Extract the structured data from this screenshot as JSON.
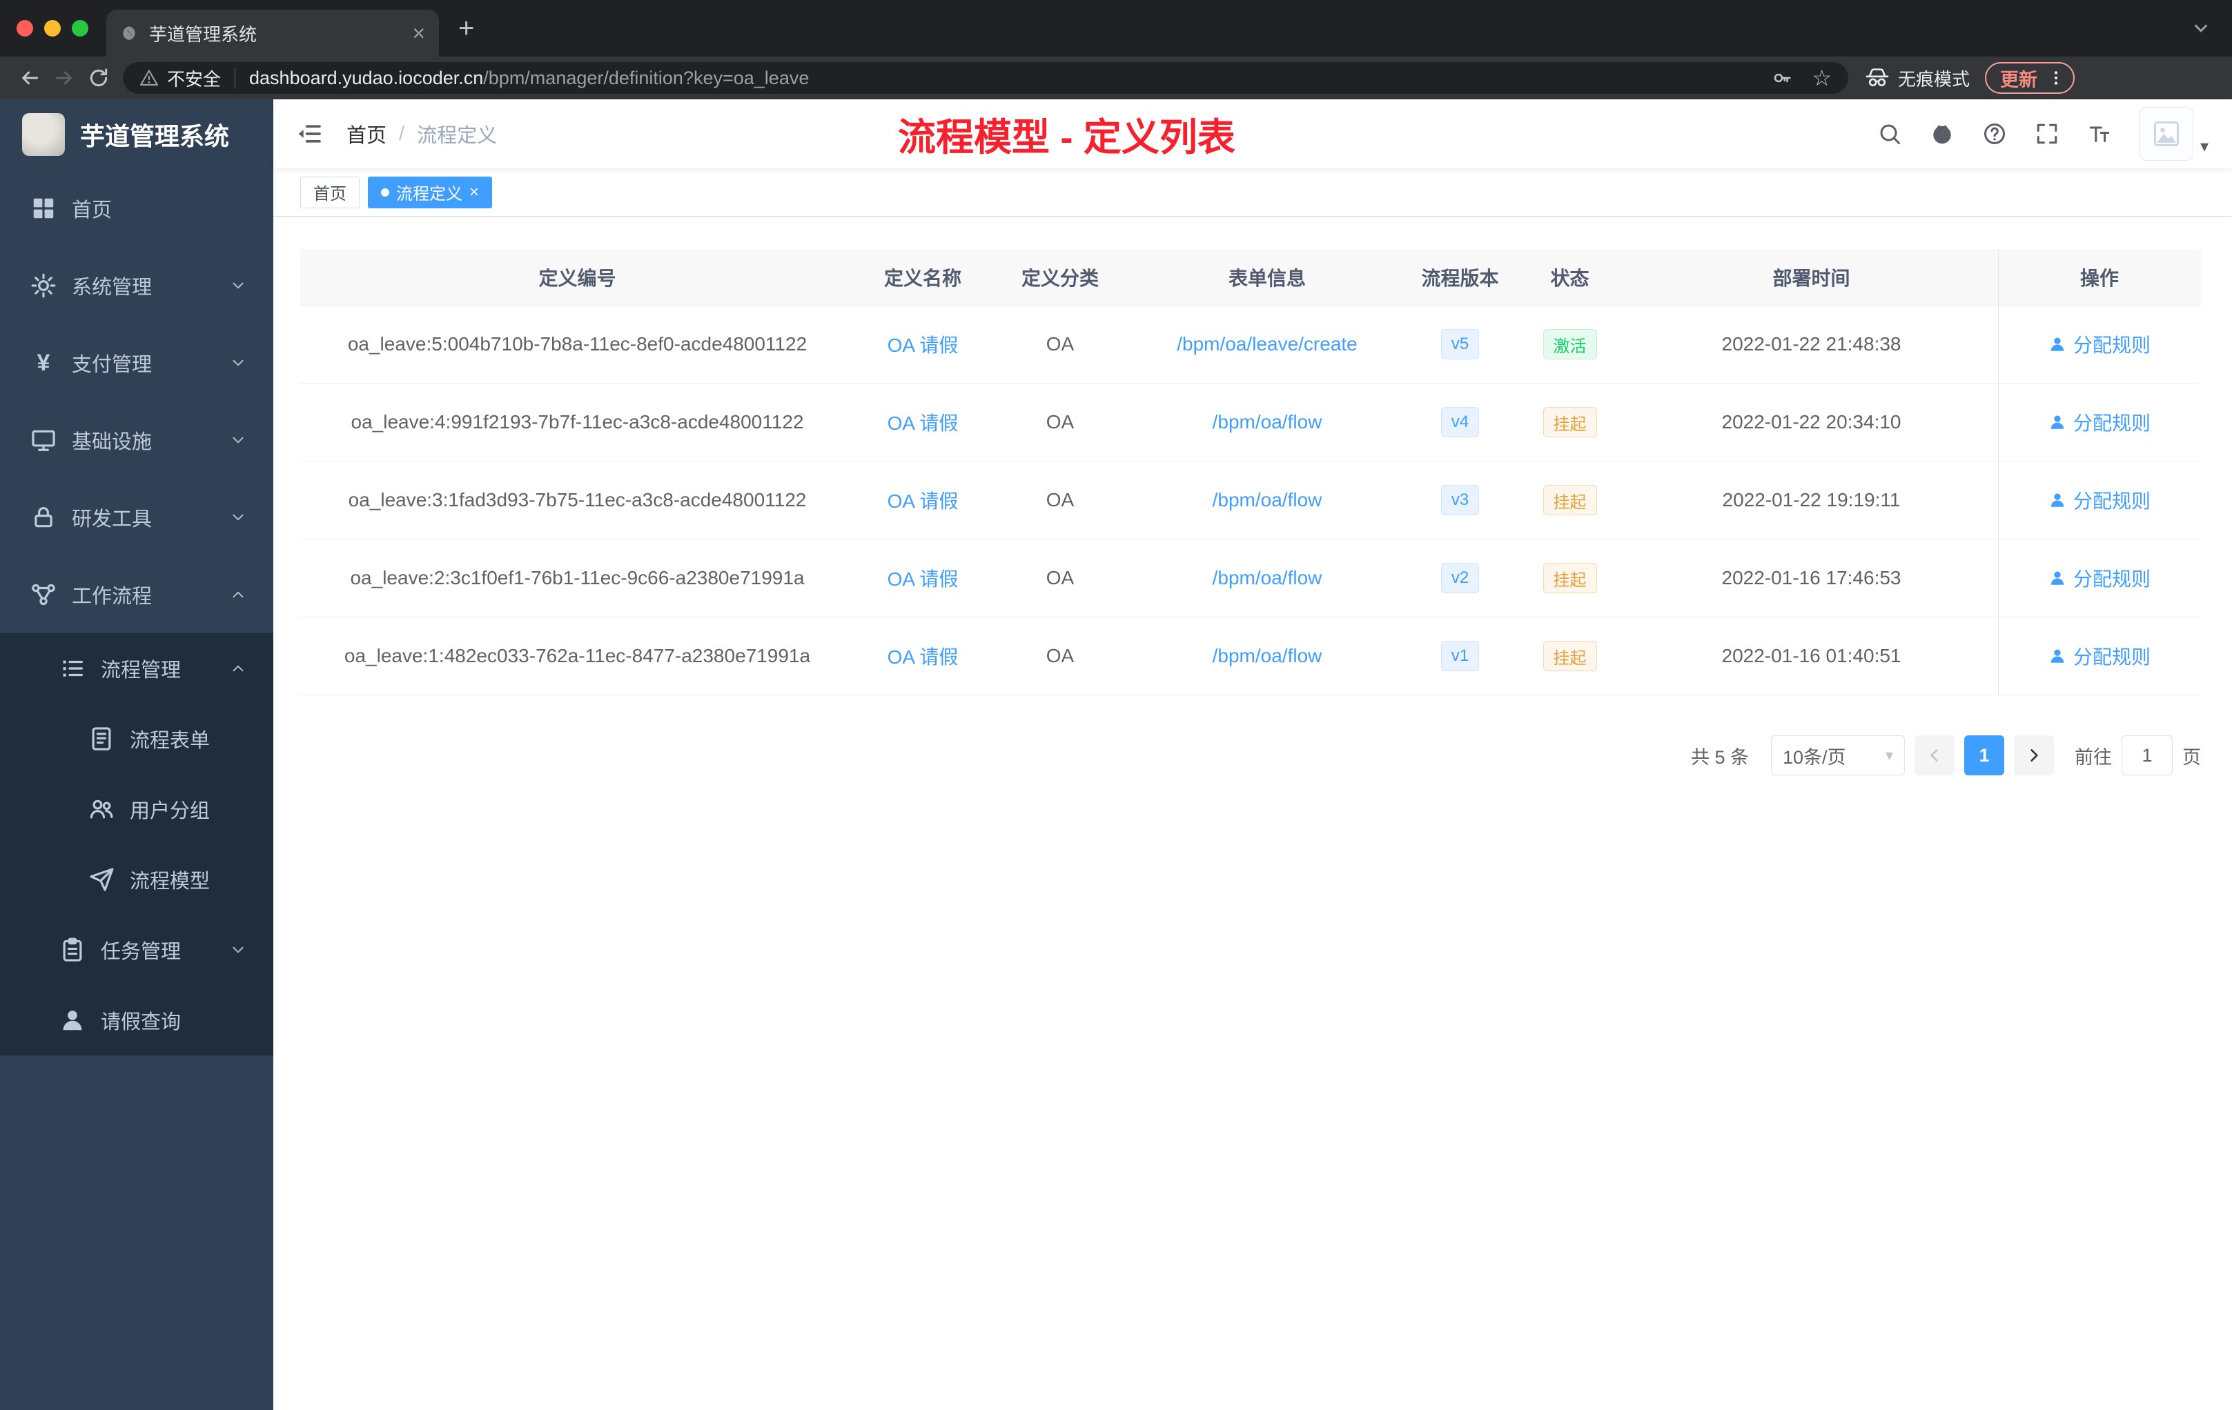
{
  "browser": {
    "tab_title": "芋道管理系统",
    "security_label": "不安全",
    "url_domain": "dashboard.yudao.iocoder.cn",
    "url_path": "/bpm/manager/definition?key=oa_leave",
    "incognito_label": "无痕模式",
    "update_label": "更新"
  },
  "sidebar": {
    "logo_title": "芋道管理系统",
    "items": [
      {
        "label": "首页",
        "icon": "dashboard-icon",
        "level": 1,
        "chevron": null,
        "dark": false
      },
      {
        "label": "系统管理",
        "icon": "gear-icon",
        "level": 1,
        "chevron": "down",
        "dark": false
      },
      {
        "label": "支付管理",
        "icon": "yen-icon",
        "level": 1,
        "chevron": "down",
        "dark": false
      },
      {
        "label": "基础设施",
        "icon": "monitor-icon",
        "level": 1,
        "chevron": "down",
        "dark": false
      },
      {
        "label": "研发工具",
        "icon": "lock-icon",
        "level": 1,
        "chevron": "down",
        "dark": false
      },
      {
        "label": "工作流程",
        "icon": "workflow-icon",
        "level": 1,
        "chevron": "up",
        "dark": false
      },
      {
        "label": "流程管理",
        "icon": "list-icon",
        "level": 2,
        "chevron": "up",
        "dark": true
      },
      {
        "label": "流程表单",
        "icon": "form-icon",
        "level": 3,
        "chevron": null,
        "dark": true
      },
      {
        "label": "用户分组",
        "icon": "users-icon",
        "level": 3,
        "chevron": null,
        "dark": true
      },
      {
        "label": "流程模型",
        "icon": "send-icon",
        "level": 3,
        "chevron": null,
        "dark": true
      },
      {
        "label": "任务管理",
        "icon": "tasks-icon",
        "level": 2,
        "chevron": "down",
        "dark": true
      },
      {
        "label": "请假查询",
        "icon": "user-icon",
        "level": 2,
        "chevron": null,
        "dark": true
      }
    ]
  },
  "header": {
    "breadcrumb_home": "首页",
    "breadcrumb_separator": "/",
    "breadcrumb_current": "流程定义",
    "annotation": "流程模型 - 定义列表",
    "icons": [
      "search-icon",
      "github-icon",
      "question-icon",
      "fullscreen-icon",
      "text-size-icon"
    ]
  },
  "tags": [
    {
      "label": "首页",
      "active": false,
      "closable": false
    },
    {
      "label": "流程定义",
      "active": true,
      "closable": true
    }
  ],
  "table": {
    "columns": [
      "定义编号",
      "定义名称",
      "定义分类",
      "表单信息",
      "流程版本",
      "状态",
      "部署时间",
      "操作"
    ],
    "action_label": "分配规则",
    "rows": [
      {
        "id": "oa_leave:5:004b710b-7b8a-11ec-8ef0-acde48001122",
        "name": "OA 请假",
        "category": "OA",
        "form": "/bpm/oa/leave/create",
        "version": "v5",
        "status": "激活",
        "status_type": "success",
        "deploy_time": "2022-01-22 21:48:38"
      },
      {
        "id": "oa_leave:4:991f2193-7b7f-11ec-a3c8-acde48001122",
        "name": "OA 请假",
        "category": "OA",
        "form": "/bpm/oa/flow",
        "version": "v4",
        "status": "挂起",
        "status_type": "warning",
        "deploy_time": "2022-01-22 20:34:10"
      },
      {
        "id": "oa_leave:3:1fad3d93-7b75-11ec-a3c8-acde48001122",
        "name": "OA 请假",
        "category": "OA",
        "form": "/bpm/oa/flow",
        "version": "v3",
        "status": "挂起",
        "status_type": "warning",
        "deploy_time": "2022-01-22 19:19:11"
      },
      {
        "id": "oa_leave:2:3c1f0ef1-76b1-11ec-9c66-a2380e71991a",
        "name": "OA 请假",
        "category": "OA",
        "form": "/bpm/oa/flow",
        "version": "v2",
        "status": "挂起",
        "status_type": "warning",
        "deploy_time": "2022-01-16 17:46:53"
      },
      {
        "id": "oa_leave:1:482ec033-762a-11ec-8477-a2380e71991a",
        "name": "OA 请假",
        "category": "OA",
        "form": "/bpm/oa/flow",
        "version": "v1",
        "status": "挂起",
        "status_type": "warning",
        "deploy_time": "2022-01-16 01:40:51"
      }
    ]
  },
  "pagination": {
    "total": "共 5 条",
    "page_size": "10条/页",
    "current_page": "1",
    "goto_label": "前往",
    "goto_value": "1",
    "unit_label": "页"
  },
  "colors": {
    "accent_blue": "#409eff",
    "success_green": "#13ce66",
    "warning_orange": "#e6a23c",
    "annotation_red": "#f5222d",
    "sidebar_bg": "#304156",
    "submenu_bg": "#1f2d3d"
  }
}
